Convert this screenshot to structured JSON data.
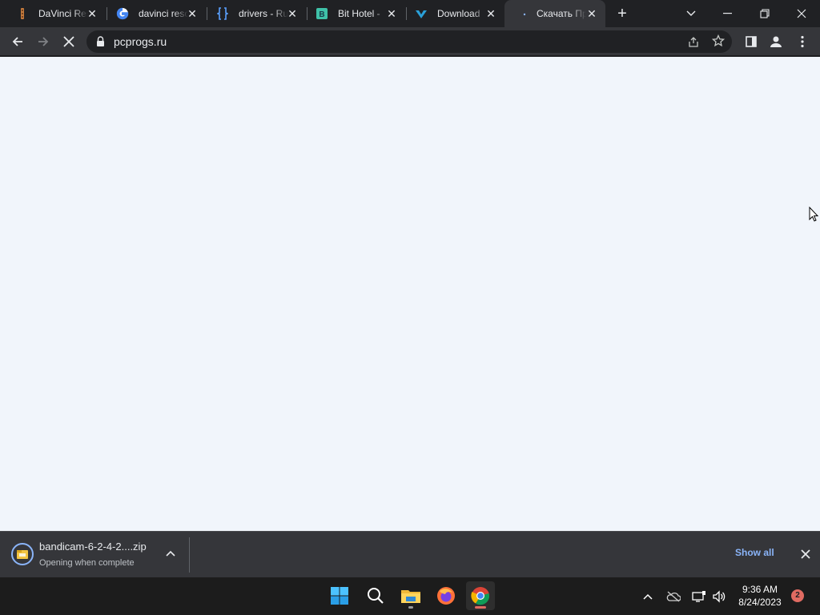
{
  "colors": {
    "tabstrip_bg": "#202124",
    "toolbar_bg": "#35363a",
    "content_bg": "#f1f5fb",
    "accent_link": "#8ab4f8",
    "taskbar_bg": "#1c1c1c",
    "notification_badge": "#e06b62"
  },
  "tabs": [
    {
      "title": "DaVinci Resolve",
      "icon": "davinci-favicon-icon",
      "active": false
    },
    {
      "title": "davinci resolve",
      "icon": "google-favicon-icon",
      "active": false
    },
    {
      "title": "drivers - Ru",
      "icon": "brackets-favicon-icon",
      "active": false
    },
    {
      "title": "Bit Hotel - ",
      "icon": "bithotel-favicon-icon",
      "active": false
    },
    {
      "title": "Download ",
      "icon": "download-favicon-icon",
      "active": false
    },
    {
      "title": "Скачать Пр",
      "icon": "loading-favicon-icon",
      "active": true
    }
  ],
  "window_controls": [
    "tab-search-icon",
    "minimize-icon",
    "restore-icon",
    "close-icon"
  ],
  "address_bar": {
    "url": "pcprogs.ru"
  },
  "downloads": {
    "filename": "bandicam-6-2-4-2....zip",
    "status": "Opening when complete",
    "show_all_label": "Show all"
  },
  "taskbar": {
    "apps": [
      "start-icon",
      "search-icon",
      "file-explorer-icon",
      "firefox-icon",
      "chrome-icon"
    ],
    "time": "9:36 AM",
    "date": "8/24/2023",
    "notification_count": "2"
  }
}
